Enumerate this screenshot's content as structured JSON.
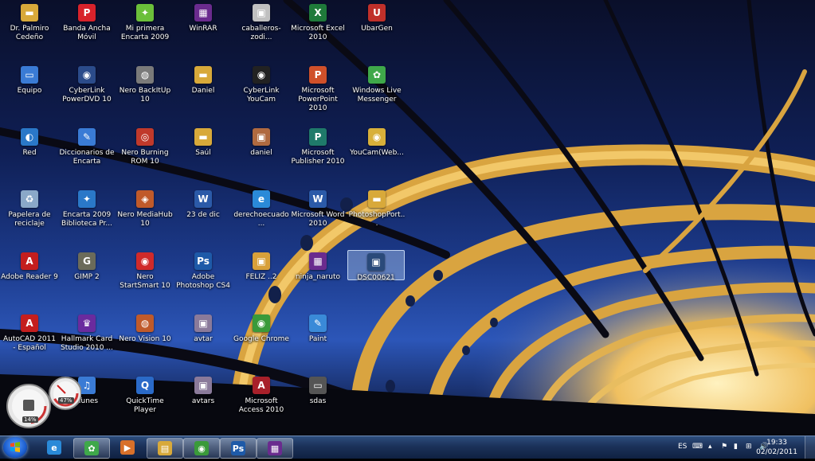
{
  "desktop": {
    "icons": [
      {
        "label": "Dr. Palmiro Cedeño",
        "icon": "folder-icon",
        "color": "#d8a93a"
      },
      {
        "label": "Banda Ancha Móvil",
        "icon": "porta-icon",
        "color": "#d8222b"
      },
      {
        "label": "Mi primera Encarta 2009",
        "icon": "encarta-icon",
        "color": "#6bbf3a"
      },
      {
        "label": "WinRAR",
        "icon": "winrar-icon",
        "color": "#6a2b8e"
      },
      {
        "label": "caballeros-zodi...",
        "icon": "image-icon",
        "color": "#c0c0c0"
      },
      {
        "label": "Microsoft Excel 2010",
        "icon": "excel-icon",
        "color": "#1f7a3a"
      },
      {
        "label": "UbarGen",
        "icon": "ubargen-icon",
        "color": "#c0302a"
      },
      {
        "label": "Equipo",
        "icon": "computer-icon",
        "color": "#3a7bd5"
      },
      {
        "label": "CyberLink PowerDVD 10",
        "icon": "powerdvd-icon",
        "color": "#2b4b8a"
      },
      {
        "label": "Nero BackItUp 10",
        "icon": "nero-backitup-icon",
        "color": "#7a7a7a"
      },
      {
        "label": "Daniel",
        "icon": "folder-icon",
        "color": "#d8a93a"
      },
      {
        "label": "CyberLink YouCam",
        "icon": "youcam-icon",
        "color": "#222"
      },
      {
        "label": "Microsoft PowerPoint 2010",
        "icon": "powerpoint-icon",
        "color": "#d0502a"
      },
      {
        "label": "Windows Live Messenger",
        "icon": "messenger-icon",
        "color": "#3fa84a"
      },
      {
        "label": "Red",
        "icon": "network-icon",
        "color": "#2a78c8"
      },
      {
        "label": "Diccionarios de Encarta",
        "icon": "encarta-dictionary-icon",
        "color": "#3a7bd5"
      },
      {
        "label": "Nero Burning ROM 10",
        "icon": "nero-burning-icon",
        "color": "#c0392b"
      },
      {
        "label": "Saúl",
        "icon": "folder-icon",
        "color": "#d8a93a"
      },
      {
        "label": "daniel",
        "icon": "image-icon",
        "color": "#b06a40"
      },
      {
        "label": "Microsoft Publisher 2010",
        "icon": "publisher-icon",
        "color": "#1f7a6a"
      },
      {
        "label": "YouCam(Web...",
        "icon": "youcam-web-icon",
        "color": "#d8b03a"
      },
      {
        "label": "Papelera de reciclaje",
        "icon": "recycle-bin-icon",
        "color": "#8aa8c8"
      },
      {
        "label": "Encarta 2009 Biblioteca Pr...",
        "icon": "encarta-library-icon",
        "color": "#2a78c8"
      },
      {
        "label": "Nero MediaHub 10",
        "icon": "nero-mediahub-icon",
        "color": "#c05a2a"
      },
      {
        "label": "23 de dic",
        "icon": "word-document-icon",
        "color": "#2b5aa8"
      },
      {
        "label": "derechoecuado...",
        "icon": "internet-explorer-icon",
        "color": "#2a8ad8"
      },
      {
        "label": "Microsoft Word 2010",
        "icon": "word-icon",
        "color": "#2b5aa8"
      },
      {
        "label": "PhotoshopPort...",
        "icon": "folder-icon",
        "color": "#d8a93a"
      },
      {
        "label": "Adobe Reader 9",
        "icon": "adobe-reader-icon",
        "color": "#c41e1e"
      },
      {
        "label": "GIMP 2",
        "icon": "gimp-icon",
        "color": "#6b6b5a"
      },
      {
        "label": "Nero StartSmart 10",
        "icon": "nero-startsmart-icon",
        "color": "#d02a2a"
      },
      {
        "label": "Adobe Photoshop CS4",
        "icon": "photoshop-icon",
        "color": "#1e5aa8"
      },
      {
        "label": "FELIZ ..2",
        "icon": "image-icon",
        "color": "#d8a03a"
      },
      {
        "label": "ninja_naruto",
        "icon": "winrar-archive-icon",
        "color": "#6a2b8e"
      },
      {
        "label": "DSC00621",
        "icon": "photo-icon",
        "color": "#2a4a7a"
      },
      {
        "label": "AutoCAD 2011 - Español",
        "icon": "autocad-icon",
        "color": "#c41e1e"
      },
      {
        "label": "Hallmark Card Studio 2010 ...",
        "icon": "hallmark-icon",
        "color": "#6a2b9e"
      },
      {
        "label": "Nero Vision 10",
        "icon": "nero-vision-icon",
        "color": "#c05a2a"
      },
      {
        "label": "avtar",
        "icon": "image-icon",
        "color": "#8a7a9a"
      },
      {
        "label": "Google Chrome",
        "icon": "chrome-icon",
        "color": "#3a9a3a"
      },
      {
        "label": "Paint",
        "icon": "paint-icon",
        "color": "#3a8ad8"
      },
      {
        "label": "iTunes",
        "icon": "itunes-icon",
        "color": "#3a7bd5"
      },
      {
        "label": "QuickTime Player",
        "icon": "quicktime-icon",
        "color": "#2a6ac8"
      },
      {
        "label": "avtars",
        "icon": "image-icon",
        "color": "#8a7a9a"
      },
      {
        "label": "Microsoft Access 2010",
        "icon": "access-icon",
        "color": "#a8202a"
      },
      {
        "label": "sdas",
        "icon": "generic-file-icon",
        "color": "#555"
      }
    ]
  },
  "gadget": {
    "cpu_percent": "14%",
    "memory_percent": "47%"
  },
  "taskbar": {
    "items": [
      {
        "icon": "internet-explorer-icon",
        "color": "#2a8ad8",
        "glyph": "e",
        "active": false
      },
      {
        "icon": "messenger-icon",
        "color": "#3fa84a",
        "glyph": "✿",
        "active": true
      },
      {
        "icon": "media-player-icon",
        "color": "#d8702a",
        "glyph": "▶",
        "active": false
      },
      {
        "icon": "windows-explorer-icon",
        "color": "#d8a93a",
        "glyph": "▤",
        "active": true
      },
      {
        "icon": "chrome-icon",
        "color": "#3a9a3a",
        "glyph": "◉",
        "active": true
      },
      {
        "icon": "photoshop-icon",
        "color": "#1e5aa8",
        "glyph": "Ps",
        "active": true
      },
      {
        "icon": "winrar-icon",
        "color": "#6a2b8e",
        "glyph": "▦",
        "active": true
      }
    ]
  },
  "tray": {
    "language": "ES",
    "time": "19:33",
    "date": "02/02/2011"
  }
}
